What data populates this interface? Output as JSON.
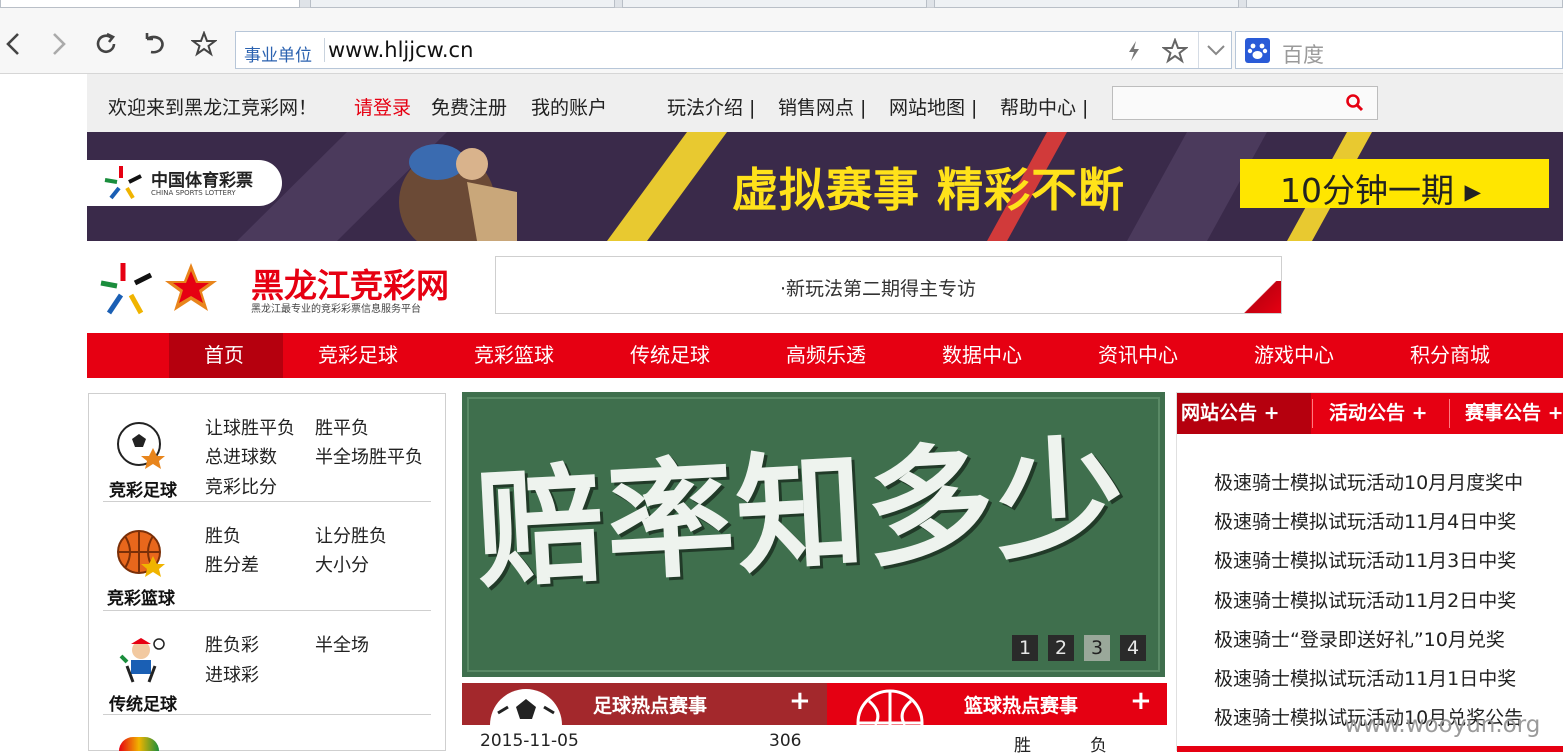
{
  "browser": {
    "address_label": "事业单位",
    "url": "www.hljjcw.cn",
    "search_placeholder": "百度"
  },
  "topbar": {
    "welcome": "欢迎来到黑龙江竞彩网！",
    "login": "请登录",
    "register": "免费注册",
    "account": "我的账户",
    "links": [
      "玩法介绍 |",
      "销售网点 |",
      "网站地图 |",
      "帮助中心 |"
    ]
  },
  "banner": {
    "org_cn": "中国体育彩票",
    "org_en": "CHINA SPORTS LOTTERY",
    "headline": "虚拟赛事 精彩不断",
    "cta": "10分钟一期 ▸"
  },
  "brand": {
    "name": "黑龙江竞彩网",
    "tagline": "黑龙江最专业的竞彩彩票信息服务平台",
    "notice": "·新玩法第二期得主专访"
  },
  "nav": {
    "items": [
      "首页",
      "竞彩足球",
      "竞彩篮球",
      "传统足球",
      "高频乐透",
      "数据中心",
      "资讯中心",
      "游戏中心",
      "积分商城"
    ]
  },
  "categories": [
    {
      "title": "竞彩足球",
      "links": [
        "让球胜平负",
        "胜平负",
        "总进球数",
        "半全场胜平负",
        "竞彩比分"
      ]
    },
    {
      "title": "竞彩篮球",
      "links": [
        "胜负",
        "让分胜负",
        "胜分差",
        "大小分"
      ]
    },
    {
      "title": "传统足球",
      "links": [
        "胜负彩",
        "半全场",
        "进球彩"
      ]
    }
  ],
  "slider": {
    "text": "赔率知多少",
    "pages": [
      "1",
      "2",
      "3",
      "4"
    ],
    "active_page": 3
  },
  "hot": {
    "football": "足球热点赛事",
    "basketball": "篮球热点赛事",
    "plus": "+"
  },
  "match_row": {
    "date": "2015-11-05",
    "num": "306",
    "win": "胜",
    "lose": "负"
  },
  "announcements": {
    "tabs": [
      "网站公告 +",
      "活动公告 +",
      "赛事公告 +"
    ],
    "items": [
      "极速骑士模拟试玩活动10月月度奖中",
      "极速骑士模拟试玩活动11月4日中奖",
      "极速骑士模拟试玩活动11月3日中奖",
      "极速骑士模拟试玩活动11月2日中奖",
      "极速骑士“登录即送好礼”10月兑奖",
      "极速骑士模拟试玩活动11月1日中奖",
      "极速骑士模拟试玩活动10月兑奖公告"
    ]
  },
  "watermark": "www.wooyun.org"
}
